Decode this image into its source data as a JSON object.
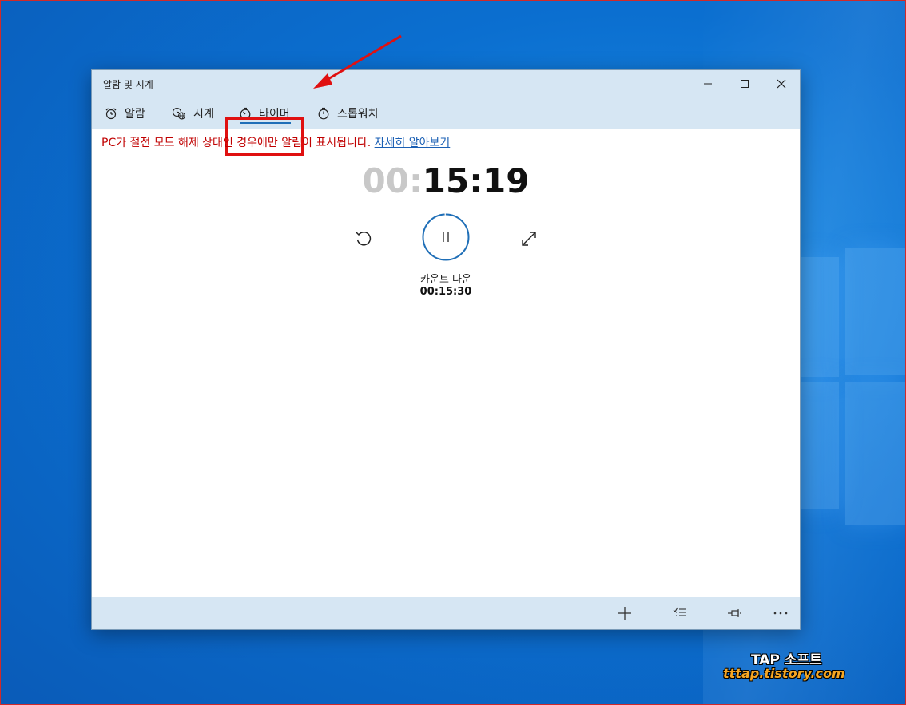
{
  "window": {
    "title": "알람 및 시계",
    "controls": {
      "minimize": "—",
      "maximize": "☐",
      "close": "✕"
    }
  },
  "tabs": [
    {
      "label": "알람",
      "icon": "alarm-clock-icon"
    },
    {
      "label": "시계",
      "icon": "world-clock-icon"
    },
    {
      "label": "타이머",
      "icon": "timer-icon",
      "selected": true
    },
    {
      "label": "스톱워치",
      "icon": "stopwatch-icon"
    }
  ],
  "notice": {
    "text": "PC가 절전 모드 해제 상태인 경우에만 알림이 표시됩니다.",
    "link": "자세히 알아보기"
  },
  "timer": {
    "hours": "00",
    "separator": ":",
    "minutes_seconds": "15:19",
    "label": "카운트 다운",
    "total": "00:15:30",
    "progress_fraction": 0.99
  },
  "bottom_toolbar": {
    "icons": [
      "add-icon",
      "select-list-icon",
      "pin-icon",
      "more-icon"
    ]
  },
  "watermark": {
    "title": "TAP 소프트",
    "url": "tttap.tistory.com"
  },
  "colors": {
    "accent": "#1f6fb8",
    "warning": "#c00000",
    "link": "#1a5fb4",
    "highlight": "#e01010",
    "bar_bg": "#d6e6f3"
  }
}
